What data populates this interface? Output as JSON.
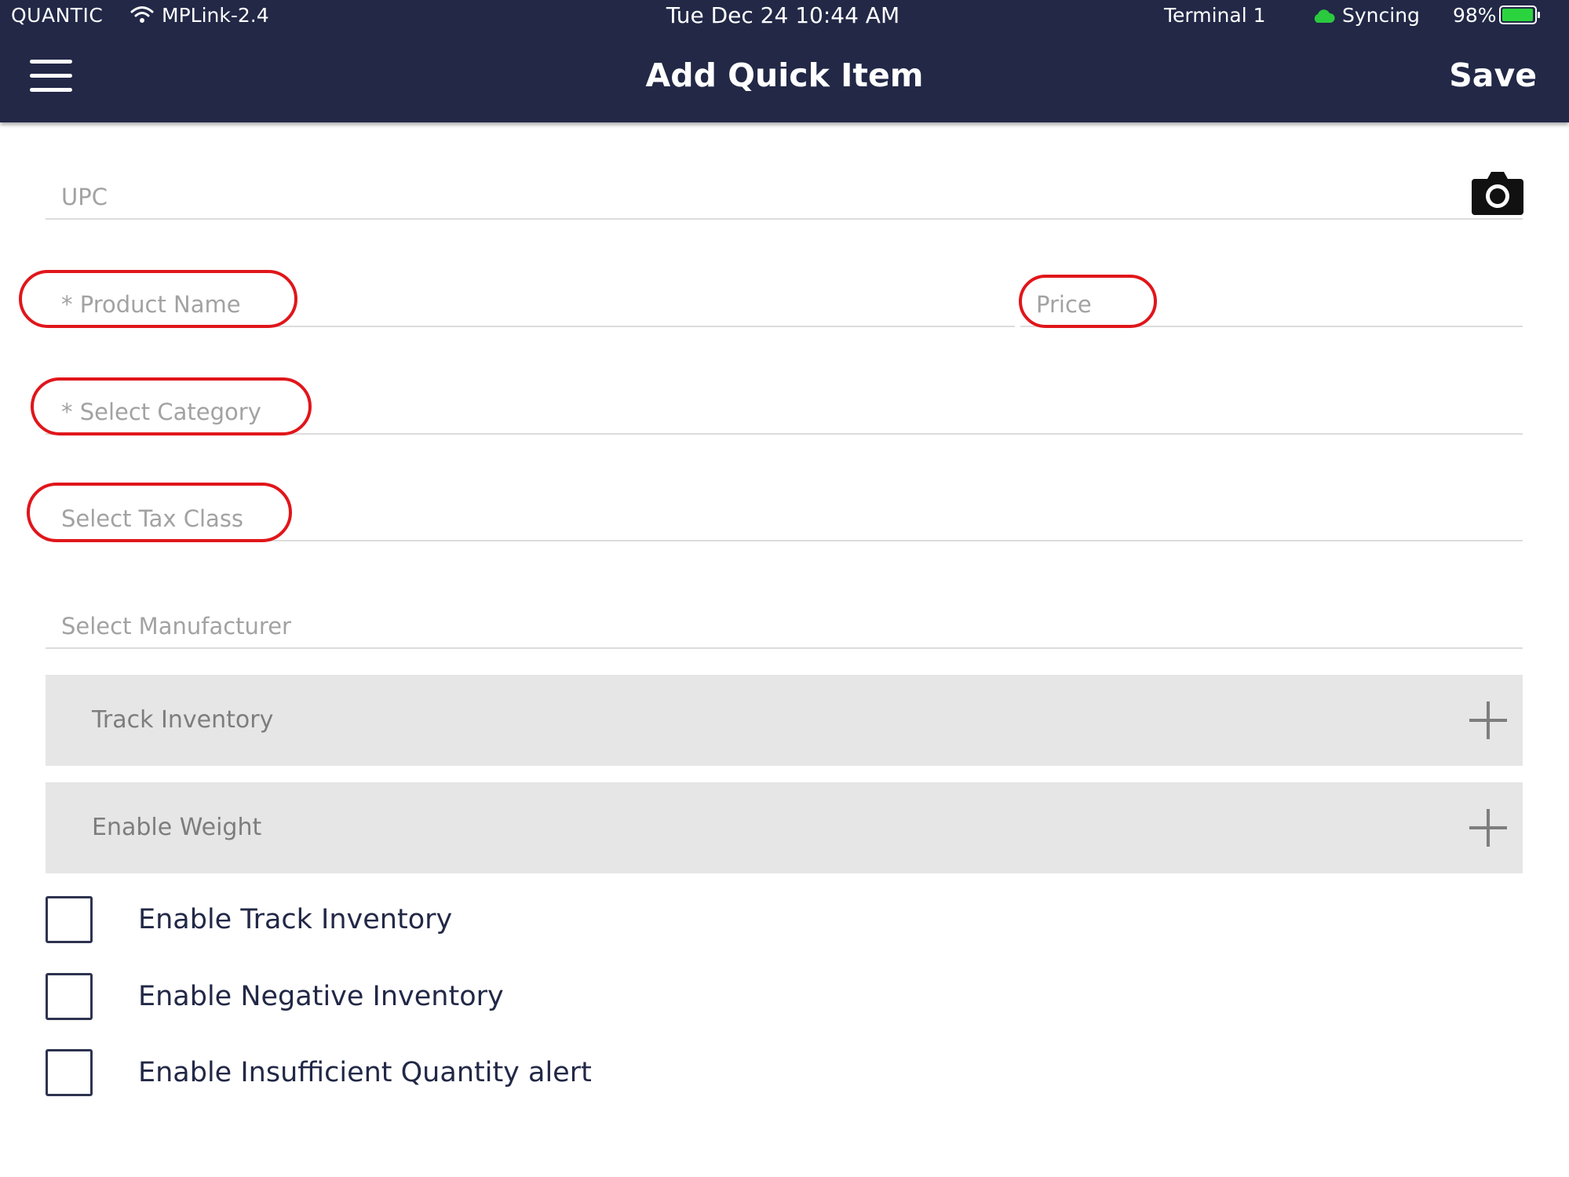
{
  "status_bar": {
    "brand": "QUANTIC",
    "network": "MPLink-2.4",
    "datetime": "Tue Dec 24 10:44 AM",
    "terminal": "Terminal 1",
    "sync_status": "Syncing",
    "battery_percent": "98%",
    "battery_level": 0.98,
    "sync_color": "#2bc93e",
    "battery_color": "#2bd43e"
  },
  "header": {
    "title": "Add Quick Item",
    "save_label": "Save",
    "background": "#222846"
  },
  "form": {
    "upc_placeholder": "UPC",
    "product_name_placeholder": "* Product Name",
    "price_placeholder": "Price",
    "category_placeholder": "* Select Category",
    "tax_class_placeholder": "Select Tax Class",
    "manufacturer_placeholder": "Select Manufacturer",
    "scan_icon": "camera-icon",
    "highlight_color": "#e0161b"
  },
  "sections": {
    "track_inventory": "Track Inventory",
    "enable_weight": "Enable Weight",
    "expand_icon": "plus-icon"
  },
  "checkboxes": [
    {
      "label": "Enable Track Inventory",
      "checked": false
    },
    {
      "label": "Enable Negative Inventory",
      "checked": false
    },
    {
      "label": "Enable Insufficient Quantity alert",
      "checked": false
    }
  ]
}
